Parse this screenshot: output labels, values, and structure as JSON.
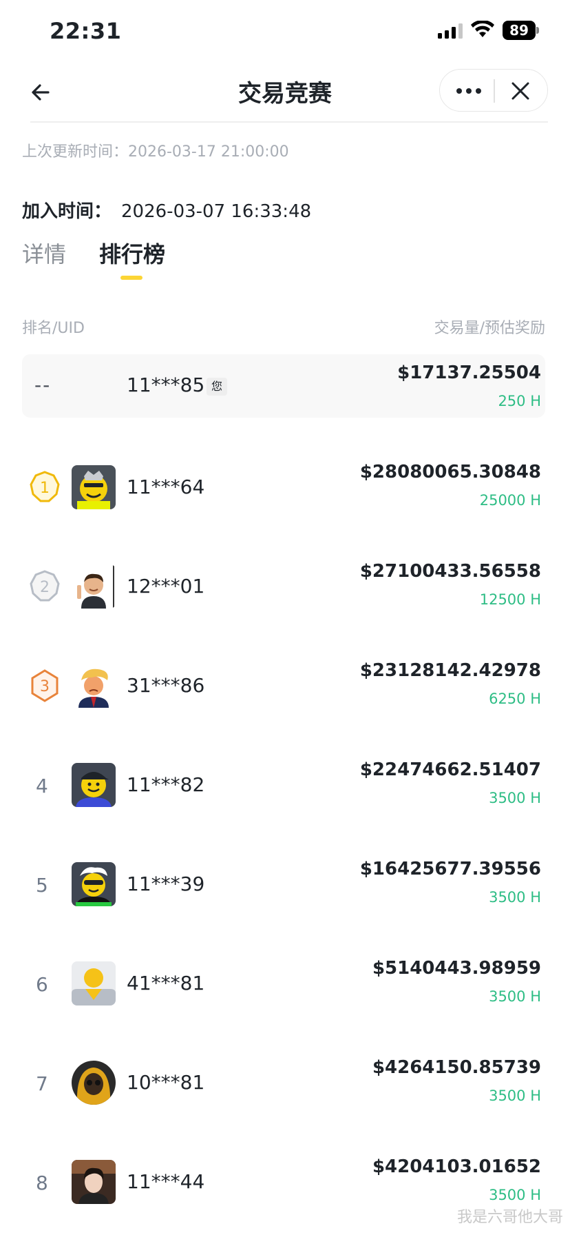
{
  "status_bar": {
    "time": "22:31",
    "battery": "89"
  },
  "nav": {
    "title": "交易竞赛",
    "back_icon": "arrow-left-icon",
    "more_icon": "more-dots-icon",
    "close_icon": "close-icon"
  },
  "updated_text": "上次更新时间：2026-03-17 21:00:00",
  "joined": {
    "label": "加入时间：",
    "value": "2026-03-07 16:33:48"
  },
  "tabs": [
    {
      "label": "详情",
      "active": false
    },
    {
      "label": "排行榜",
      "active": true
    }
  ],
  "columns": {
    "left": "排名/UID",
    "right": "交易量/预估奖励"
  },
  "my_entry": {
    "rank": "--",
    "uid": "11***85",
    "badge": "您",
    "volume": "$17137.25504",
    "reward": "250 H"
  },
  "leaderboard": [
    {
      "rank": "1",
      "uid": "11***64",
      "volume": "$28080065.30848",
      "reward": "25000 H",
      "medal": "gold-medal-icon",
      "avatar": "smiley-crown-avatar"
    },
    {
      "rank": "2",
      "uid": "12***01",
      "volume": "$27100433.56558",
      "reward": "12500 H",
      "medal": "silver-medal-icon",
      "avatar": "cartoon-man-avatar"
    },
    {
      "rank": "3",
      "uid": "31***86",
      "volume": "$23128142.42978",
      "reward": "6250 H",
      "medal": "bronze-medal-icon",
      "avatar": "cartoon-blond-man-avatar"
    },
    {
      "rank": "4",
      "uid": "11***82",
      "volume": "$22474662.51407",
      "reward": "3500 H",
      "avatar": "smiley-cap-avatar"
    },
    {
      "rank": "5",
      "uid": "11***39",
      "volume": "$16425677.39556",
      "reward": "3500 H",
      "avatar": "smiley-sunglasses-avatar"
    },
    {
      "rank": "6",
      "uid": "41***81",
      "volume": "$5140443.98959",
      "reward": "3500 H",
      "avatar": "default-avatar"
    },
    {
      "rank": "7",
      "uid": "10***81",
      "volume": "$4264150.85739",
      "reward": "3500 H",
      "avatar": "hooded-figure-avatar"
    },
    {
      "rank": "8",
      "uid": "11***44",
      "volume": "$4204103.01652",
      "reward": "3500 H",
      "avatar": "portrait-avatar"
    }
  ],
  "watermark": "我是六哥他大哥",
  "colors": {
    "accent": "#fcd535",
    "reward_green": "#2ebd85",
    "gold": "#f0b90b",
    "silver": "#b7bdc6",
    "bronze": "#e8833a"
  }
}
